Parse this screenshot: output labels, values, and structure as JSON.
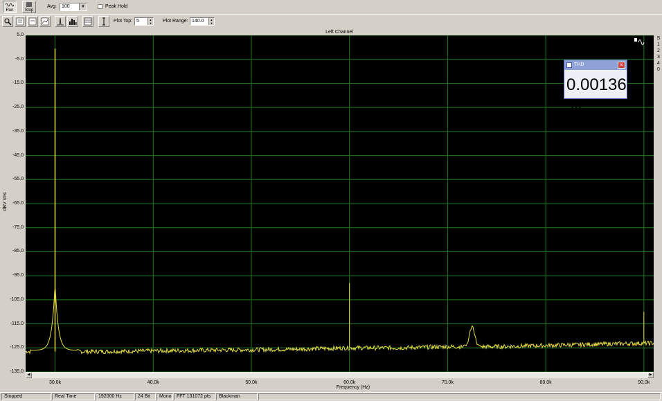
{
  "toolbar": {
    "run_label": "Run",
    "stop_label": "Stop",
    "avg_label": "Avg:",
    "avg_value": "100",
    "peak_hold_label": "Peak Hold",
    "plot_top_label": "Plot Top:",
    "plot_top_value": "5",
    "plot_range_label": "Plot Range:",
    "plot_range_value": "140.0"
  },
  "chart": {
    "title": "Left Channel",
    "ylabel": "dBV rms",
    "xlabel": "Frequency (Hz)"
  },
  "chart_data": {
    "type": "line",
    "title": "Left Channel",
    "xlabel": "Frequency (Hz)",
    "ylabel": "dBV rms",
    "xlim": [
      27000,
      91000
    ],
    "ylim": [
      -135,
      5
    ],
    "yticks": [
      "5.0",
      "-5.0",
      "-15.0",
      "-25.0",
      "-35.0",
      "-45.0",
      "-55.0",
      "-65.0",
      "-75.0",
      "-85.0",
      "-95.0",
      "-105.0",
      "-115.0",
      "-125.0",
      "-135.0"
    ],
    "xticks": [
      "30.0k",
      "40.0k",
      "50.0k",
      "60.0k",
      "70.0k",
      "80.0k",
      "90.0k"
    ],
    "grid": true,
    "noise_floor": [
      [
        27000,
        -126.5
      ],
      [
        35000,
        -126.5
      ],
      [
        45000,
        -126.0
      ],
      [
        55000,
        -125.5
      ],
      [
        60000,
        -125
      ],
      [
        65000,
        -125
      ],
      [
        70000,
        -124.5
      ],
      [
        75000,
        -124.5
      ],
      [
        80000,
        -124
      ],
      [
        85000,
        -123.5
      ],
      [
        91000,
        -123
      ]
    ],
    "peaks": [
      {
        "x": 30000,
        "y": -0.5
      },
      {
        "x": 60000,
        "y": -98
      },
      {
        "x": 72500,
        "y": -116
      },
      {
        "x": 90000,
        "y": -110
      }
    ]
  },
  "thd": {
    "title": "THD",
    "value": "0.00136 %"
  },
  "right_panel": [
    "S",
    "1",
    "2",
    "3",
    "4",
    "0"
  ],
  "status": {
    "state": "Stopped",
    "mode": "Real Time",
    "rate": "192000 Hz",
    "bits": "24 Bit",
    "channels": "Mono",
    "fft": "FFT 131072 pts",
    "window": "Blackman"
  },
  "colors": {
    "plot_bg": "#000000",
    "grid": "#1f7a1f",
    "trace": "#e8e040"
  }
}
